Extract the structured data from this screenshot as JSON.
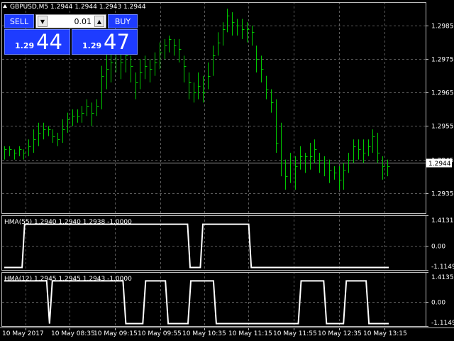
{
  "window": {
    "title": "GBPUSD,M5  1.2944 1.2944 1.2943 1.2944"
  },
  "trade_panel": {
    "sell_label": "SELL",
    "buy_label": "BUY",
    "lot_value": "0.01",
    "sell_price_prefix": "1.29",
    "sell_price_big": "44",
    "buy_price_prefix": "1.29",
    "buy_price_big": "47"
  },
  "colors": {
    "background": "#000000",
    "candles": "#00c800",
    "grid": "#5a5a5a",
    "indicator_line": "#ffffff",
    "panel_blue": "#1e3cff"
  },
  "chart_data": [
    {
      "type": "ohlc",
      "symbol": "GBPUSD",
      "timeframe": "M5",
      "ylim": [
        1.2929,
        1.2992
      ],
      "yticks": [
        "1.2985",
        "1.2975",
        "1.2965",
        "1.2955",
        "1.2945",
        "1.2935"
      ],
      "current_price_label": "1.2944",
      "current_price": 1.2944,
      "x_labels": [
        "10 May 2017",
        "10 May 08:35",
        "10 May 09:15",
        "10 May 09:55",
        "10 May 10:35",
        "10 May 11:15",
        "10 May 11:55",
        "10 May 12:35",
        "10 May 13:15"
      ],
      "bars": [
        [
          1.2948,
          1.2945,
          1.2949
        ],
        [
          1.2948,
          1.2946,
          1.2949
        ],
        [
          1.2947,
          1.2945,
          1.2948
        ],
        [
          1.2948,
          1.2946,
          1.2949
        ],
        [
          1.2947,
          1.2945,
          1.2948
        ],
        [
          1.2949,
          1.2946,
          1.2951
        ],
        [
          1.2951,
          1.2947,
          1.2954
        ],
        [
          1.2953,
          1.2949,
          1.2956
        ],
        [
          1.2954,
          1.2951,
          1.2956
        ],
        [
          1.2954,
          1.2952,
          1.2955
        ],
        [
          1.2952,
          1.295,
          1.2954
        ],
        [
          1.2951,
          1.2949,
          1.2953
        ],
        [
          1.2954,
          1.295,
          1.2957
        ],
        [
          1.2957,
          1.2953,
          1.2959
        ],
        [
          1.2958,
          1.2955,
          1.296
        ],
        [
          1.2958,
          1.2956,
          1.296
        ],
        [
          1.2959,
          1.2956,
          1.2961
        ],
        [
          1.2961,
          1.2958,
          1.2963
        ],
        [
          1.2959,
          1.2955,
          1.2962
        ],
        [
          1.2961,
          1.2958,
          1.2963
        ],
        [
          1.297,
          1.296,
          1.2973
        ],
        [
          1.2972,
          1.2966,
          1.2978
        ],
        [
          1.2974,
          1.2968,
          1.2979
        ],
        [
          1.2977,
          1.2971,
          1.2981
        ],
        [
          1.2974,
          1.2969,
          1.2977
        ],
        [
          1.2976,
          1.2971,
          1.2978
        ],
        [
          1.2973,
          1.2968,
          1.2976
        ],
        [
          1.2968,
          1.2963,
          1.2971
        ],
        [
          1.2971,
          1.2966,
          1.2975
        ],
        [
          1.2973,
          1.2969,
          1.2976
        ],
        [
          1.2972,
          1.2968,
          1.2975
        ],
        [
          1.2974,
          1.297,
          1.2977
        ],
        [
          1.2977,
          1.2972,
          1.298
        ],
        [
          1.2979,
          1.2975,
          1.2981
        ],
        [
          1.2981,
          1.2977,
          1.2982
        ],
        [
          1.2979,
          1.2976,
          1.2981
        ],
        [
          1.2978,
          1.2974,
          1.2981
        ],
        [
          1.2973,
          1.2968,
          1.2976
        ],
        [
          1.2968,
          1.2963,
          1.2971
        ],
        [
          1.2965,
          1.2962,
          1.2968
        ],
        [
          1.2967,
          1.2963,
          1.2971
        ],
        [
          1.2965,
          1.2962,
          1.297
        ],
        [
          1.297,
          1.2966,
          1.2974
        ],
        [
          1.2976,
          1.297,
          1.2979
        ],
        [
          1.298,
          1.2976,
          1.2983
        ],
        [
          1.2984,
          1.2979,
          1.2986
        ],
        [
          1.2988,
          1.2983,
          1.299
        ],
        [
          1.2986,
          1.2982,
          1.2989
        ],
        [
          1.2985,
          1.2982,
          1.2987
        ],
        [
          1.2984,
          1.2981,
          1.2987
        ],
        [
          1.2984,
          1.298,
          1.2986
        ],
        [
          1.2983,
          1.2979,
          1.2985
        ],
        [
          1.2975,
          1.2971,
          1.2979
        ],
        [
          1.2972,
          1.2968,
          1.2976
        ],
        [
          1.2966,
          1.2963,
          1.297
        ],
        [
          1.2962,
          1.2959,
          1.2966
        ],
        [
          1.295,
          1.2947,
          1.2963
        ],
        [
          1.2944,
          1.294,
          1.2956
        ],
        [
          1.294,
          1.2936,
          1.2945
        ],
        [
          1.2944,
          1.2938,
          1.2947
        ],
        [
          1.2943,
          1.2936,
          1.2946
        ],
        [
          1.2946,
          1.2942,
          1.2949
        ],
        [
          1.2946,
          1.2941,
          1.2947
        ],
        [
          1.2946,
          1.2942,
          1.295
        ],
        [
          1.2948,
          1.2944,
          1.2951
        ],
        [
          1.2945,
          1.2941,
          1.2947
        ],
        [
          1.2944,
          1.294,
          1.2946
        ],
        [
          1.2942,
          1.2938,
          1.2945
        ],
        [
          1.2941,
          1.2939,
          1.2943
        ],
        [
          1.2939,
          1.2936,
          1.2943
        ],
        [
          1.2942,
          1.2936,
          1.2944
        ],
        [
          1.2945,
          1.2941,
          1.2947
        ],
        [
          1.2949,
          1.2944,
          1.2951
        ],
        [
          1.2948,
          1.2945,
          1.2951
        ],
        [
          1.2947,
          1.2944,
          1.2951
        ],
        [
          1.2949,
          1.2946,
          1.2951
        ],
        [
          1.2952,
          1.2947,
          1.2954
        ],
        [
          1.2947,
          1.2944,
          1.2953
        ],
        [
          1.2943,
          1.2939,
          1.2946
        ],
        [
          1.2943,
          1.294,
          1.2945
        ]
      ]
    },
    {
      "type": "line",
      "label": "HMA(55) 1.2940 1.2940 1.2938 -1.0000",
      "ylim": [
        -1.1149,
        1.4131
      ],
      "yticks": [
        "1.4131",
        "0.00",
        "-1.1149"
      ],
      "tick_values": [
        1.4131,
        0.0,
        -1.1149
      ],
      "high": 1.0,
      "low": -1.0,
      "values": [
        -1,
        -1,
        -1,
        -1,
        -1,
        -1,
        -1,
        -1,
        1,
        1,
        1,
        1,
        1,
        1,
        1,
        1,
        1,
        1,
        1,
        1,
        1,
        1,
        1,
        1,
        1,
        1,
        1,
        1,
        1,
        1,
        1,
        1,
        1,
        1,
        1,
        1,
        1,
        1,
        1,
        1,
        1,
        1,
        1,
        1,
        1,
        1,
        1,
        1,
        1,
        1,
        1,
        1,
        1,
        1,
        1,
        1,
        1,
        1,
        1,
        1,
        1,
        1,
        1,
        1,
        1,
        1,
        1,
        1,
        1,
        1,
        1,
        1,
        1,
        -1,
        -1,
        -1,
        -1,
        -1,
        1,
        1,
        1,
        1,
        1,
        1,
        1,
        1,
        1,
        1,
        1,
        1,
        1,
        1,
        1,
        1,
        1,
        1,
        1,
        -1,
        -1,
        -1,
        -1,
        -1,
        -1,
        -1,
        -1,
        -1,
        -1,
        -1,
        -1,
        -1,
        -1,
        -1,
        -1,
        -1,
        -1,
        -1,
        -1,
        -1,
        -1,
        -1,
        -1,
        -1,
        -1,
        -1,
        -1,
        -1,
        -1,
        -1,
        -1,
        -1,
        -1,
        -1,
        -1,
        -1,
        -1,
        -1,
        -1,
        -1,
        -1,
        -1,
        -1,
        -1,
        -1,
        -1,
        -1,
        -1,
        -1,
        -1,
        -1,
        -1,
        -1,
        -1
      ]
    },
    {
      "type": "line",
      "label": "HMA(12) 1.2945 1.2945 1.2943 -1.0000",
      "ylim": [
        -1.1149,
        1.4135
      ],
      "yticks": [
        "1.4135",
        "0.00",
        "-1.1149"
      ],
      "tick_values": [
        1.4135,
        0.0,
        -1.1149
      ],
      "high": 1.0,
      "low": -1.0,
      "values": [
        1,
        1,
        1,
        1,
        1,
        1,
        1,
        1,
        1,
        1,
        1,
        1,
        1,
        1,
        1,
        1,
        -1,
        1,
        1,
        1,
        1,
        1,
        1,
        1,
        1,
        1,
        1,
        1,
        1,
        1,
        1,
        1,
        1,
        1,
        1,
        1,
        1,
        1,
        1,
        1,
        1,
        1,
        1,
        -1,
        -1,
        -1,
        -1,
        -1,
        -1,
        -1,
        1,
        1,
        1,
        1,
        1,
        1,
        1,
        1,
        -1,
        -1,
        -1,
        -1,
        -1,
        -1,
        -1,
        -1,
        1,
        1,
        1,
        1,
        1,
        1,
        1,
        1,
        1,
        -1,
        -1,
        -1,
        -1,
        -1,
        -1,
        -1,
        -1,
        -1,
        -1,
        -1,
        -1,
        -1,
        -1,
        -1,
        -1,
        -1,
        -1,
        -1,
        -1,
        -1,
        -1,
        -1,
        -1,
        -1,
        -1,
        -1,
        -1,
        -1,
        -1,
        1,
        1,
        1,
        1,
        1,
        1,
        1,
        1,
        1,
        -1,
        -1,
        -1,
        -1,
        -1,
        -1,
        -1,
        1,
        1,
        1,
        1,
        1,
        1,
        1,
        1,
        -1,
        -1,
        -1,
        -1,
        -1,
        -1,
        -1,
        -1
      ]
    }
  ]
}
